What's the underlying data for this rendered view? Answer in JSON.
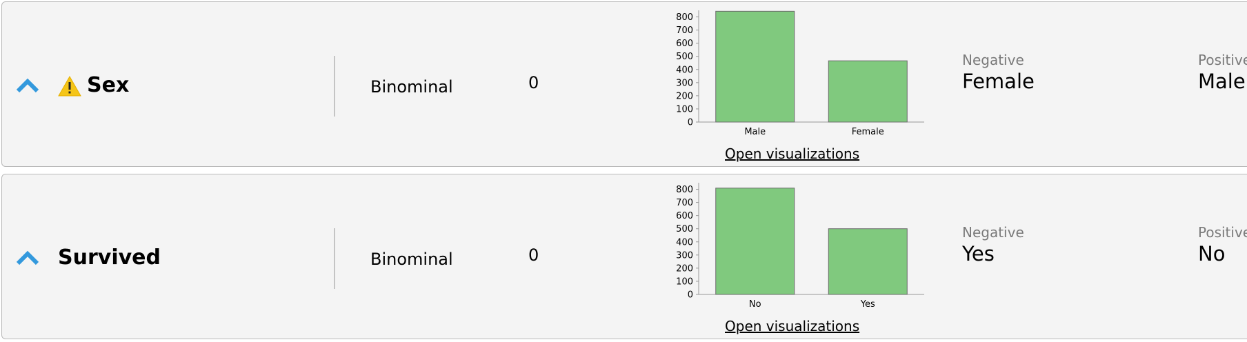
{
  "attributes": [
    {
      "name": "Sex",
      "has_warning": true,
      "type": "Binominal",
      "missing": "0",
      "open_visualizations_label": "Open visualizations",
      "negative_label": "Negative",
      "negative_value": "Female",
      "positive_label": "Positive",
      "positive_value": "Male",
      "chart_data": {
        "type": "bar",
        "categories": [
          "Male",
          "Female"
        ],
        "values": [
          843,
          466
        ],
        "ylim": [
          0,
          850
        ],
        "yticks": [
          0,
          100,
          200,
          300,
          400,
          500,
          600,
          700,
          800
        ],
        "bar_color": "#80c97e"
      }
    },
    {
      "name": "Survived",
      "has_warning": false,
      "type": "Binominal",
      "missing": "0",
      "open_visualizations_label": "Open visualizations",
      "negative_label": "Negative",
      "negative_value": "Yes",
      "positive_label": "Positive",
      "positive_value": "No",
      "chart_data": {
        "type": "bar",
        "categories": [
          "No",
          "Yes"
        ],
        "values": [
          809,
          500
        ],
        "ylim": [
          0,
          850
        ],
        "yticks": [
          0,
          100,
          200,
          300,
          400,
          500,
          600,
          700,
          800
        ],
        "bar_color": "#80c97e"
      }
    }
  ],
  "colors": {
    "panel_bg": "#f4f4f4",
    "collapse_icon": "#3399dd",
    "warning_icon": "#f5c518",
    "muted_text": "#7a7a7a"
  },
  "icons": {
    "collapse": "chevron-up-icon",
    "warning": "warning-icon"
  }
}
